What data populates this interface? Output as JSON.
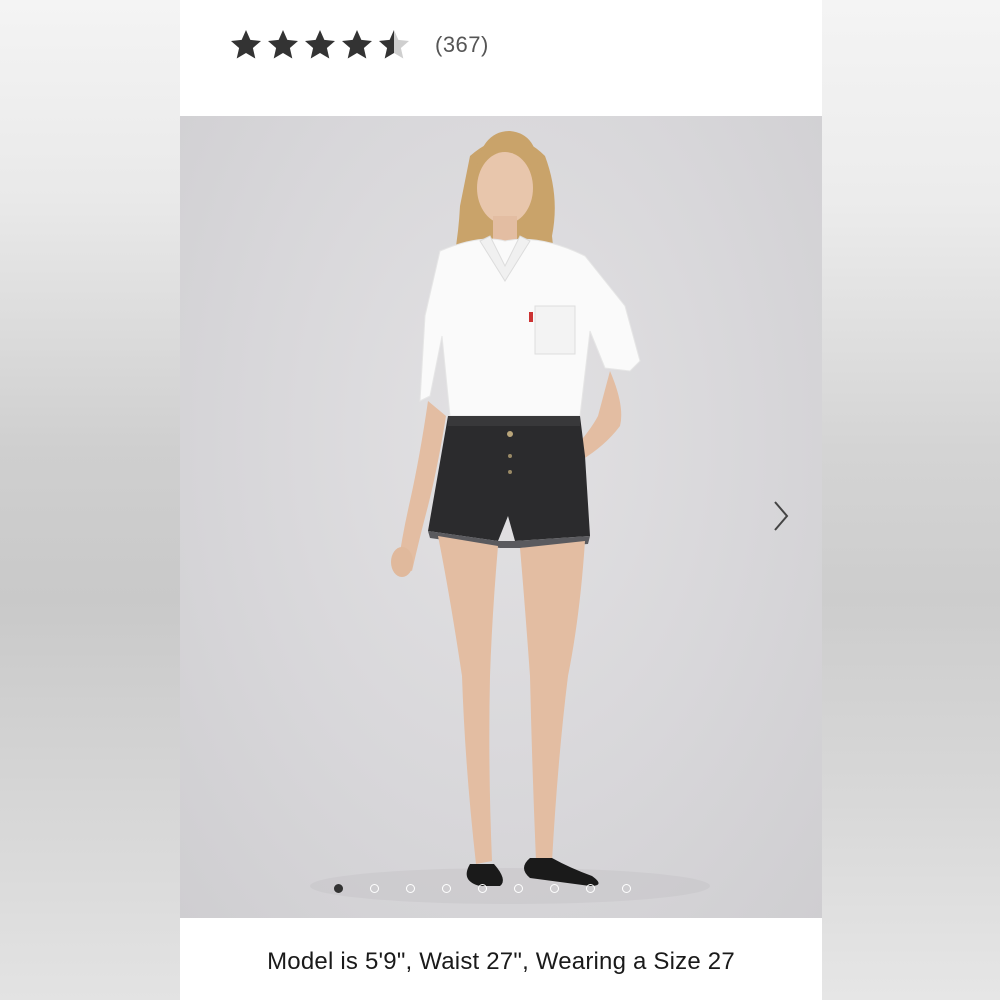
{
  "rating": {
    "stars_filled": 4.5,
    "stars_total": 5,
    "count_label": "(367)",
    "star_color": "#333333",
    "star_empty_color": "#cccccc"
  },
  "gallery": {
    "image_alt": "Model wearing white oversized button-up shirt and black denim cutoff shorts",
    "next_icon": "chevron-right-icon",
    "dots_total": 9,
    "active_dot": 0
  },
  "caption": {
    "text": "Model is 5'9\", Waist 27\", Wearing a Size 27"
  }
}
